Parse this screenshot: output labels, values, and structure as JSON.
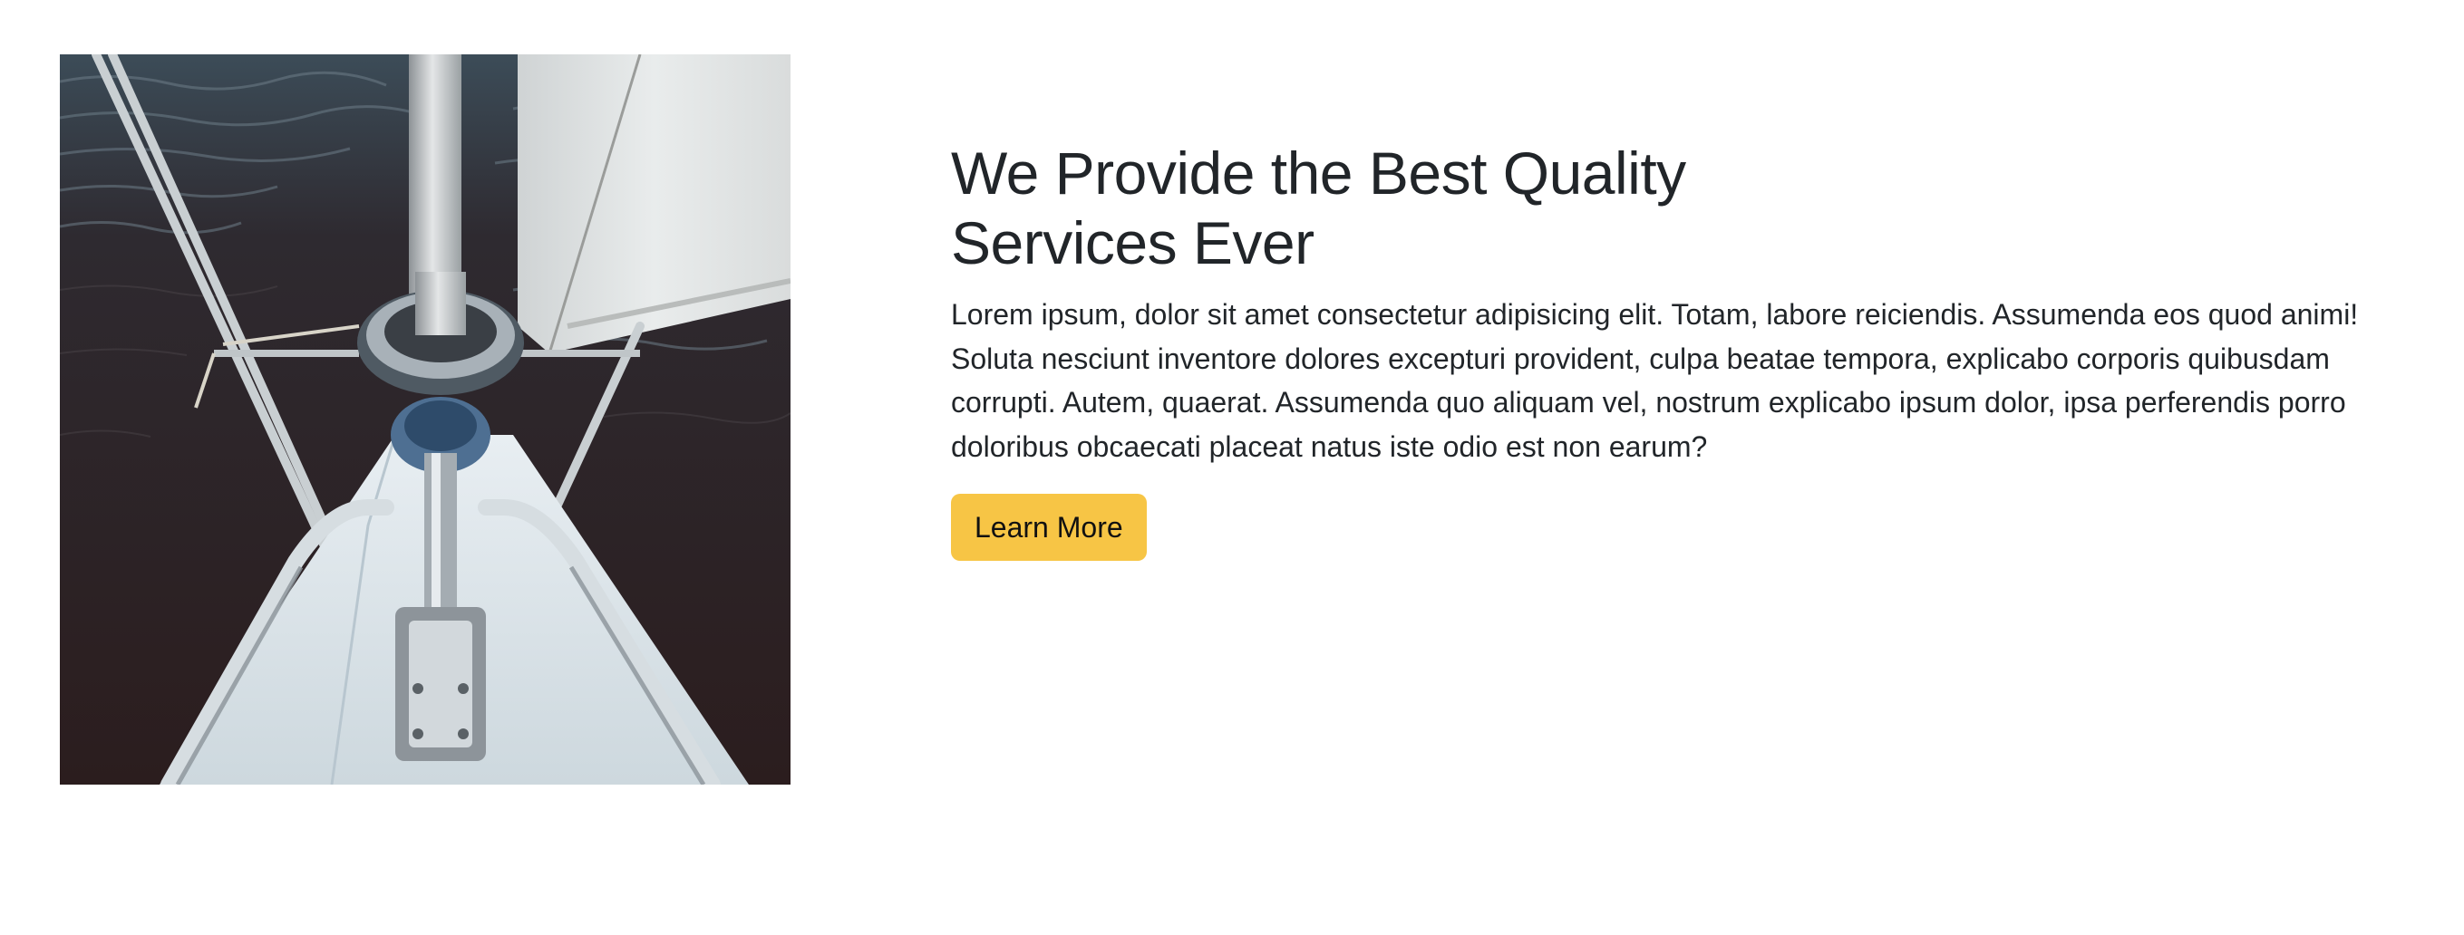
{
  "feature": {
    "image_alt": "Sailboat bow and mast over dark water",
    "heading": "We Provide the Best Quality Services Ever",
    "body": "Lorem ipsum, dolor sit amet consectetur adipisicing elit. Totam, labore reiciendis. Assumenda eos quod animi! Soluta nesciunt inventore dolores excepturi provident, culpa beatae tempora, explicabo corporis quibusdam corrupti. Autem, quaerat. Assumenda quo aliquam vel, nostrum explicabo ipsum dolor, ipsa perferendis porro doloribus obcaecati placeat natus iste odio est non earum?",
    "button_label": "Learn More"
  },
  "colors": {
    "button": "#f7c545",
    "text": "#212529",
    "water": "#2a1c1d"
  }
}
